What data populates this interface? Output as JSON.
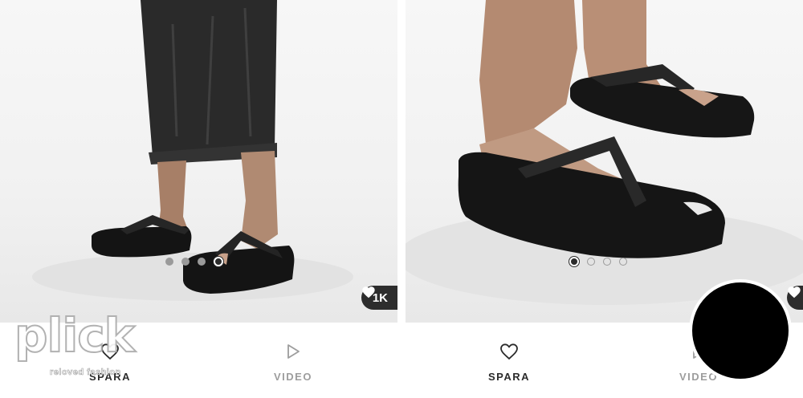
{
  "cards": [
    {
      "image_alt": "Person in black wide-leg trousers wearing black quilted platform flip flops",
      "carousel": {
        "count": 4,
        "active_index": 3
      },
      "likes": "1K",
      "actions": {
        "save_label": "SPARA",
        "video_label": "VIDEO"
      }
    },
    {
      "image_alt": "Close-up of feet in black quilted platform flip flops",
      "carousel": {
        "count": 4,
        "active_index": 0
      },
      "actions": {
        "save_label": "SPARA",
        "video_label": "VIDEO"
      }
    }
  ],
  "watermark": {
    "brand": "plick",
    "tagline": "reloved fashion"
  },
  "icons": {
    "save": "heart-outline-icon",
    "video": "play-outline-icon",
    "likes": "heart-filled-icon"
  },
  "colors": {
    "badge_bg": "#2d2d2d",
    "label_dark": "#2b2b2b",
    "label_muted": "#9d9d9d"
  }
}
